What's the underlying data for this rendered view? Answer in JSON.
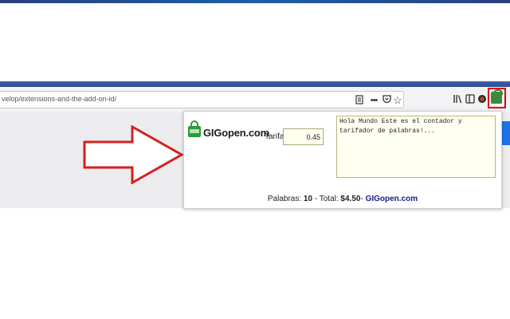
{
  "browser": {
    "url": "velop/extensions-and-the-add-on-id/",
    "icons": {
      "reader_view": "reader-view-icon",
      "page_actions": "•••",
      "pocket": "pocket-icon",
      "bookmark": "☆",
      "library": "library-icon",
      "sidebar": "sidebar-icon",
      "profile": "profile-icon",
      "extension": "gigopen-extension-icon"
    }
  },
  "popup": {
    "brand_name": "GIGopen.com",
    "tarifa_label": "Tarifa:",
    "tarifa_value": "0.45",
    "text_value": "Hola Mundo Este es el contador y tarifador de palabras!...",
    "footer": {
      "words_label": "Palabras: ",
      "words_count": "10",
      "total_label": " - Total: ",
      "total_value": "$4.50",
      "sep": "- ",
      "brand": "GIGopen.com"
    }
  },
  "colors": {
    "highlight_red": "#e00000",
    "brand_green": "#2d9a3c",
    "footer_brand": "#1a1a8c"
  }
}
